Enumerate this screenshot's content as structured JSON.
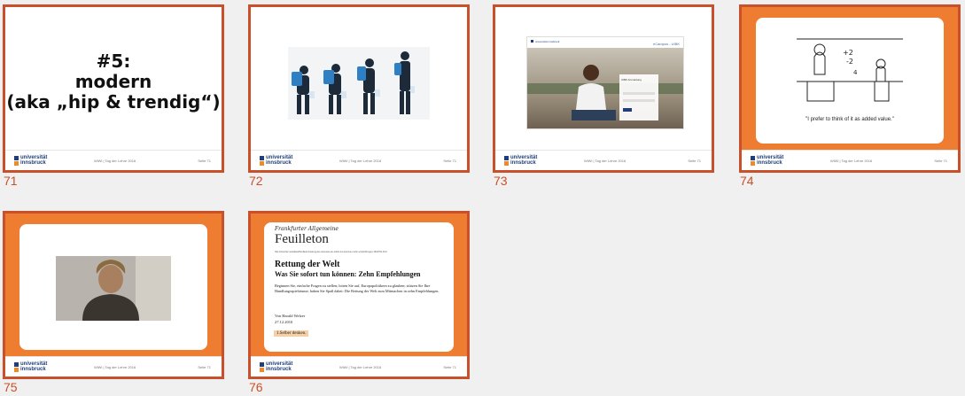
{
  "colors": {
    "frame": "#c8502a",
    "orange": "#ee7d31",
    "uni_blue": "#1f3e7a"
  },
  "slides": [
    {
      "number": "71",
      "title_lines": [
        "#5:",
        "modern",
        "(aka „hip & trendig“)"
      ]
    },
    {
      "number": "72"
    },
    {
      "number": "73"
    },
    {
      "number": "74",
      "caption": "\"I prefer to think of it as added value.\""
    },
    {
      "number": "75"
    },
    {
      "number": "76",
      "masthead": "Frankfurter Allgemeine",
      "section": "Feuilleton",
      "url": "http://www.faz.net/aktuell/feuilleton/rettung-der-welt-was-sie-sofort-tun-koennen-zehn-empfehlungen-1619791.html",
      "headline1": "Rettung der Welt",
      "headline2": "Was Sie sofort tun können: Zehn Empfehlungen",
      "body": "Beginnen Sie, einfache Fragen zu stellen; hören Sie auf, Europapolitikern zu glauben; stützen Sie Ihre Handlungsspielräume; haben Sie Spaß dabei: Die Rettung der Welt zum Mitmachen in zehn Empfehlungen.",
      "byline": "Von Harald Welzer",
      "date": "27.12.2010",
      "highlight": "1.Selber denken."
    }
  ],
  "footer": {
    "logo_line1": "universität",
    "logo_line2": "innsbruck",
    "mid": "WiWi | Tag der Lehre 2016",
    "right": "Seite 71"
  },
  "slide73": {
    "logo": "universität innsbruck",
    "link": "eCampus - UIBK",
    "panel_title": "UIBK Anmeldung"
  }
}
